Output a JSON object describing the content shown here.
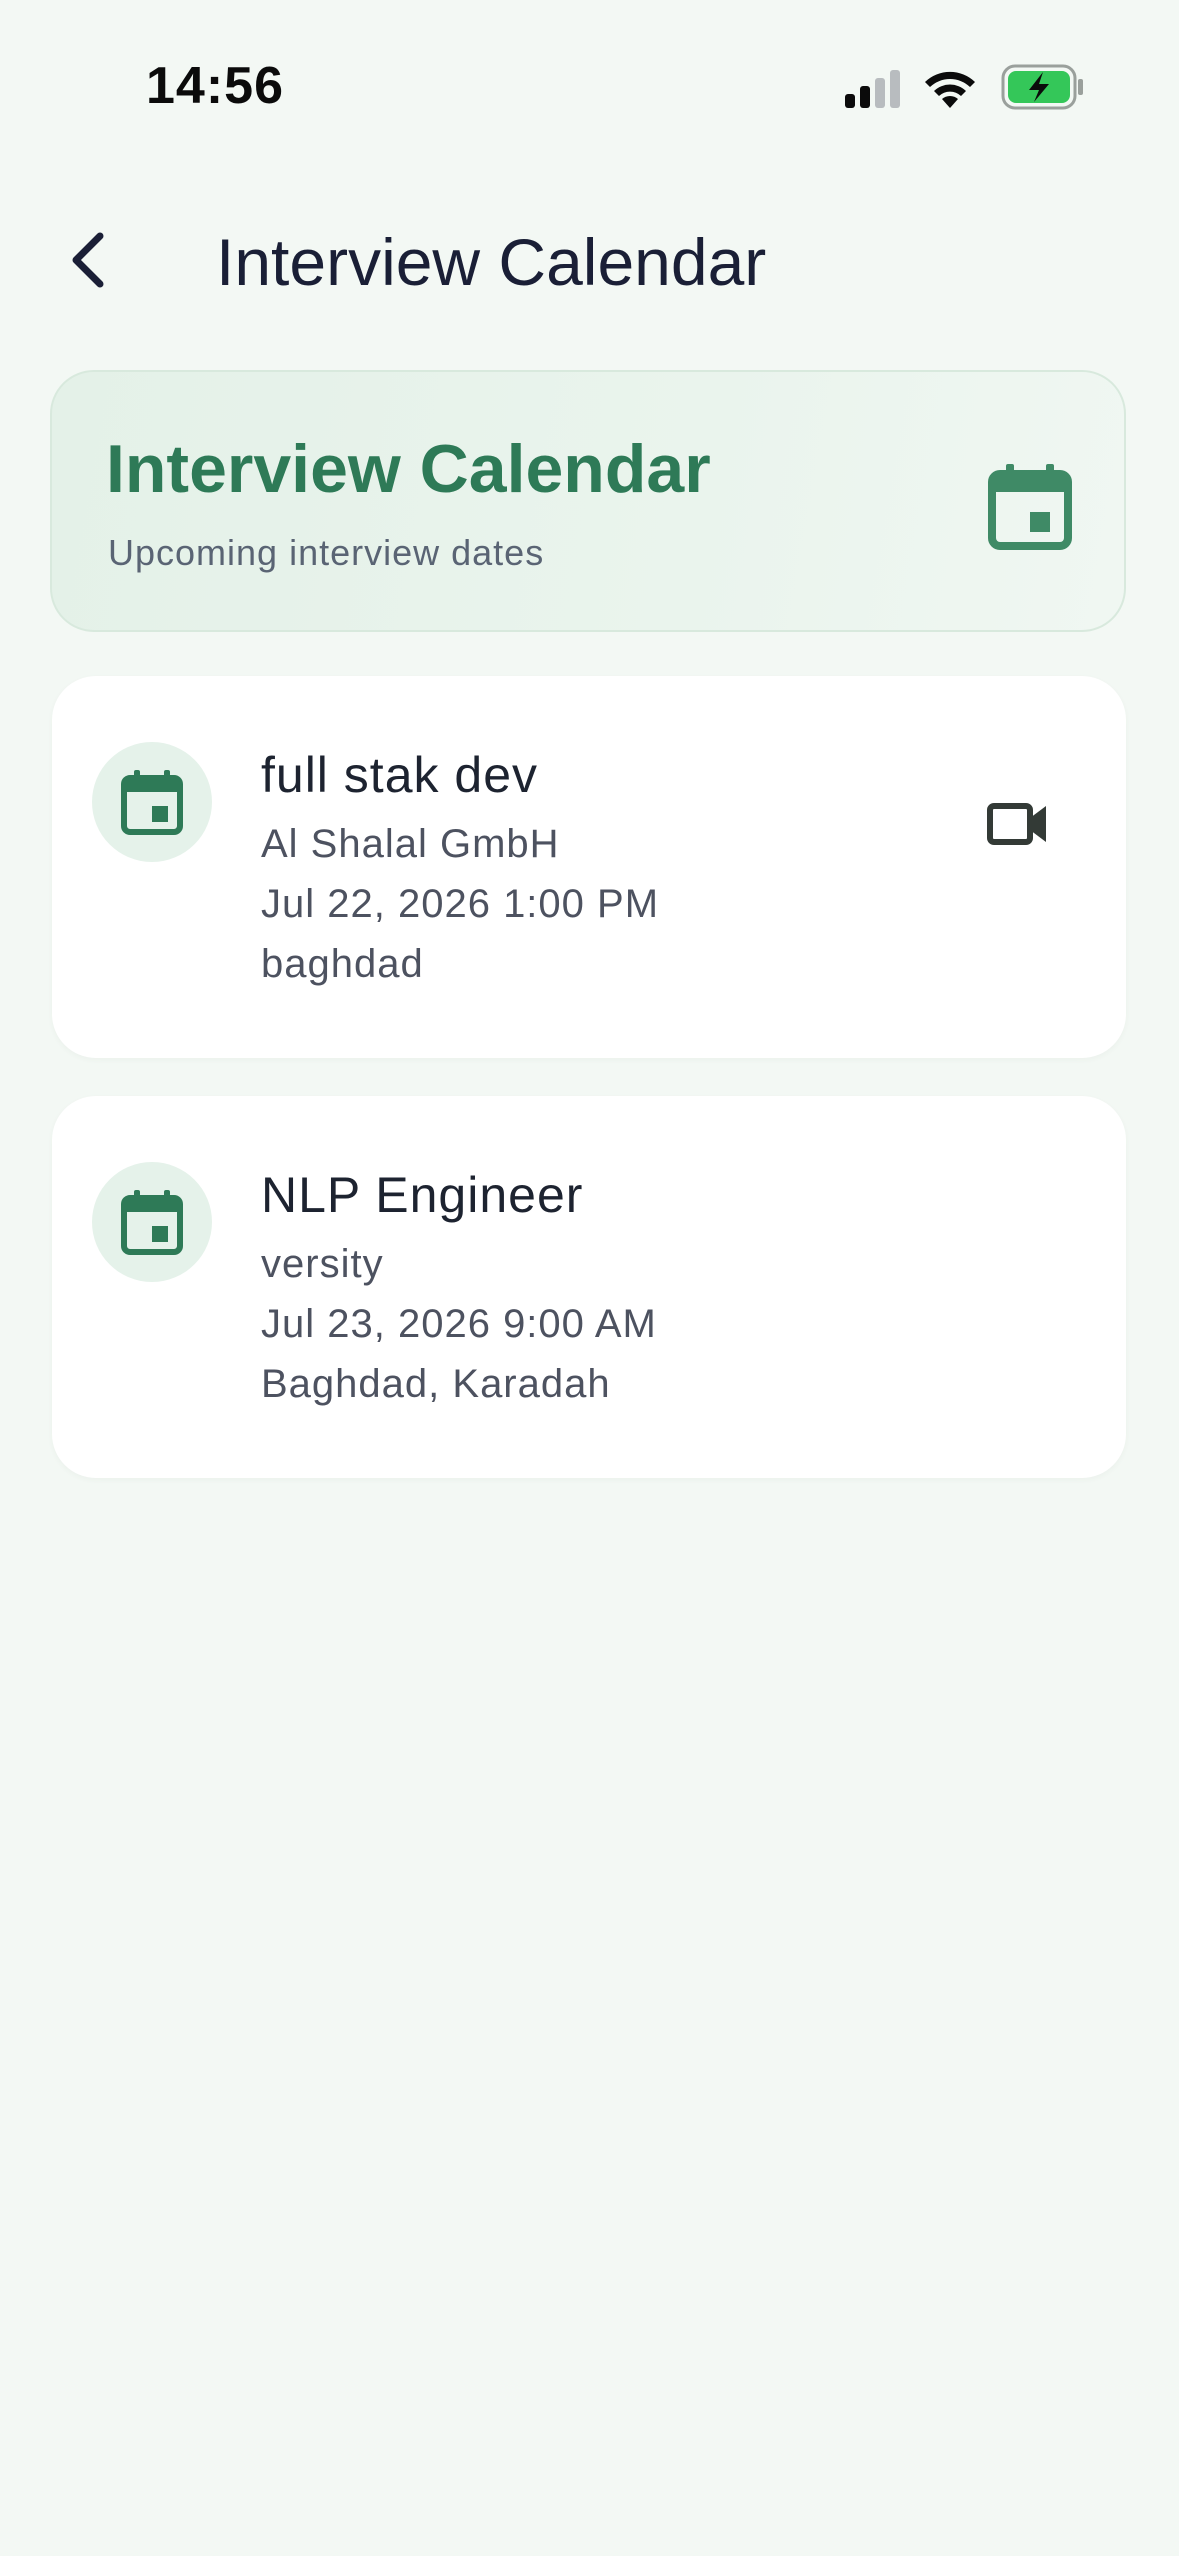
{
  "status_bar": {
    "time": "14:56",
    "signal_icon": "cellular-signal-icon",
    "wifi_icon": "wifi-icon",
    "battery_icon": "battery-charging-icon",
    "battery_color": "#34c759"
  },
  "header": {
    "back_icon": "chevron-left-icon",
    "title": "Interview Calendar"
  },
  "banner": {
    "title": "Interview Calendar",
    "subtitle": "Upcoming interview dates",
    "icon": "calendar-icon",
    "accent_color": "#2e7a57"
  },
  "interviews": [
    {
      "position": "full stak dev",
      "company": "Al Shalal GmbH",
      "datetime": "Jul 22, 2026 1:00 PM",
      "location": "baghdad",
      "icon": "calendar-icon",
      "action_icon": "video-camera-icon"
    },
    {
      "position": "NLP Engineer",
      "company": "versity",
      "datetime": "Jul 23, 2026 9:00 AM",
      "location": "Baghdad, Karadah",
      "icon": "calendar-icon"
    }
  ]
}
